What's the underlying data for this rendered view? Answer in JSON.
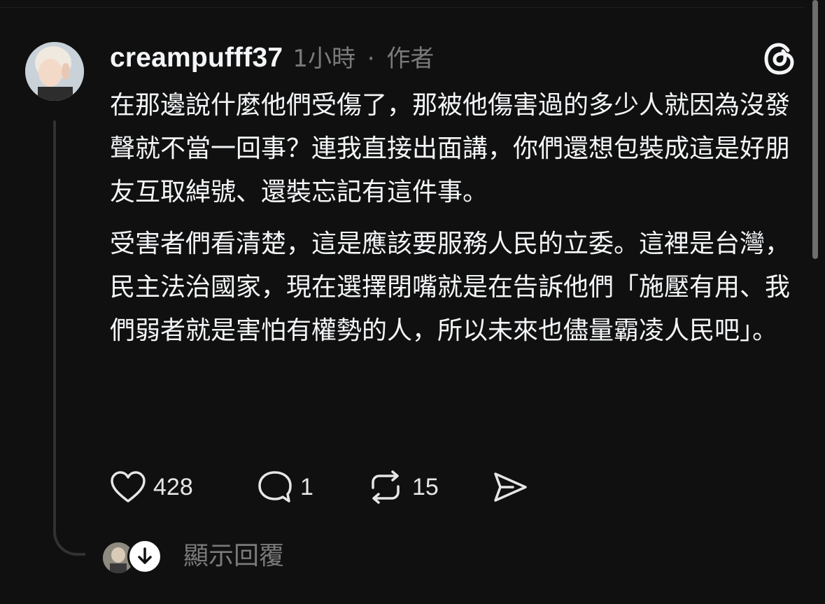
{
  "post": {
    "username": "creampufff37",
    "time": "1小時",
    "separator": "·",
    "role": "作者",
    "paragraphs": [
      "在那邊說什麼他們受傷了，那被他傷害過的多少人就因為沒發聲就不當一回事？連我直接出面講，你們還想包裝成這是好朋友互取綽號、還裝忘記有這件事。",
      "受害者們看清楚，這是應該要服務人民的立委。這裡是台灣，民主法治國家，現在選擇閉嘴就是在告訴他們「施壓有用、我們弱者就是害怕有權勢的人，所以未來也儘量霸凌人民吧」。"
    ]
  },
  "actions": {
    "likes": "428",
    "comments": "1",
    "reposts": "15"
  },
  "replies": {
    "show_label": "顯示回覆"
  },
  "icons": {
    "brand": "threads-logo-icon",
    "like": "heart-icon",
    "comment": "comment-bubble-icon",
    "repost": "repost-icon",
    "share": "send-icon",
    "expand": "arrow-down-icon"
  },
  "colors": {
    "background": "#101010",
    "text": "#f3f5f7",
    "muted": "#7a7a7a",
    "thread_line": "#323232"
  }
}
